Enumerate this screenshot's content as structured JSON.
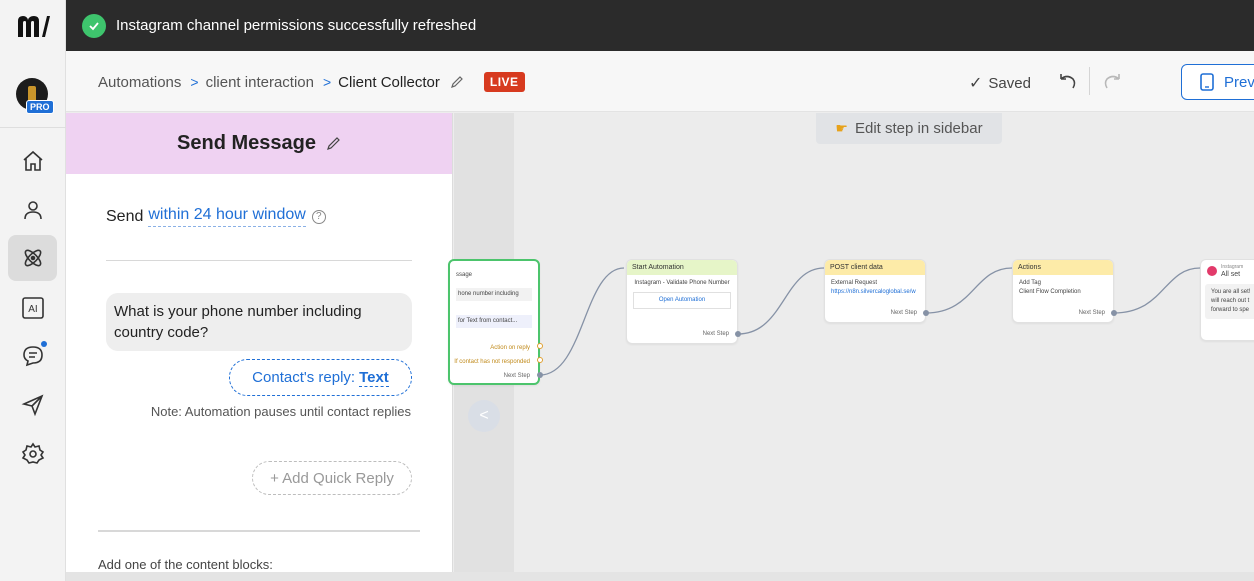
{
  "toast": {
    "message": "Instagram channel permissions successfully refreshed",
    "status_color": "#3ec46d"
  },
  "header": {
    "breadcrumbs": [
      "Automations",
      "client interaction",
      "Client Collector"
    ],
    "live_badge": "LIVE",
    "saved_label": "Saved",
    "preview_label": "Prev",
    "accent_color": "#1f6fd6"
  },
  "rail": {
    "pro_badge": "PRO",
    "items": [
      "home-icon",
      "contacts-icon",
      "automation-icon",
      "ai-icon",
      "chat-icon",
      "broadcast-icon",
      "settings-icon"
    ],
    "ai_label": "AI"
  },
  "panel": {
    "title": "Send Message",
    "send_prefix": "Send",
    "send_window": "within 24 hour window",
    "help": "?",
    "message": "What is your phone number including country code?",
    "reply_prefix": "Contact's reply:",
    "reply_type": "Text",
    "note": "Note: Automation pauses until contact replies",
    "quick_reply": "+ Add Quick Reply",
    "add_blocks": "Add one of the content blocks:",
    "header_color": "#efd2f2"
  },
  "canvas": {
    "edit_tip": "Edit step in sidebar",
    "nodes": {
      "send_message": {
        "line1": "ssage",
        "line2": "hone number including",
        "line3": "for Text from contact...",
        "action_reply": "Action on reply",
        "no_response": "If contact has not responded",
        "next_step": "Next Step"
      },
      "start_automation": {
        "title": "Start Automation",
        "body": "Instagram - Validate Phone Number",
        "link": "Open Automation",
        "next_step": "Next Step"
      },
      "post_client": {
        "title": "POST client data",
        "subtitle": "External Request",
        "url": "https://n8n.silvercaloglobal.se/w",
        "next_step": "Next Step"
      },
      "actions": {
        "title": "Actions",
        "subtitle": "Add Tag",
        "body": "Client Flow Completion",
        "next_step": "Next Step"
      },
      "instagram": {
        "channel": "Instagram",
        "title": "All set",
        "body": "You are all set! will reach out t forward to spe"
      }
    }
  }
}
